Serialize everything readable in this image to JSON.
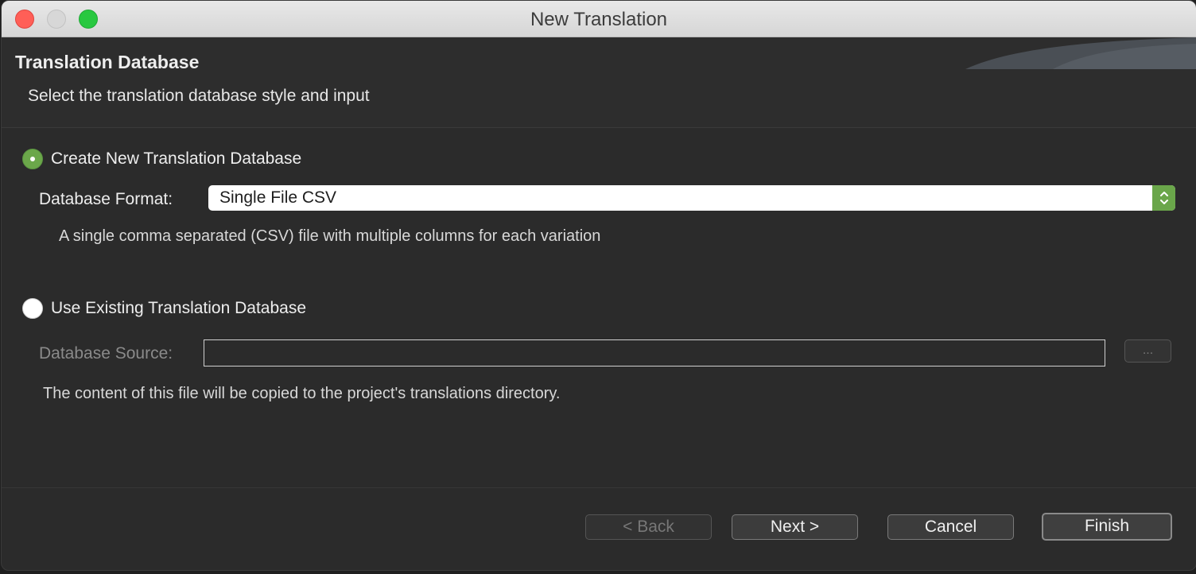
{
  "window": {
    "title": "New Translation"
  },
  "banner": {
    "title": "Translation Database",
    "subtitle": "Select the translation database style and input"
  },
  "create_new": {
    "label": "Create New Translation Database",
    "selected": true,
    "format_label": "Database Format:",
    "format_value": "Single File CSV",
    "format_description": "A single comma separated (CSV) file with multiple columns for each variation"
  },
  "use_existing": {
    "label": "Use Existing Translation Database",
    "selected": false,
    "source_label": "Database Source:",
    "source_value": "",
    "browse_label": "...",
    "note": "The content of this file will be copied to the project's translations directory."
  },
  "buttons": {
    "back": "< Back",
    "next": "Next >",
    "cancel": "Cancel",
    "finish": "Finish"
  },
  "colors": {
    "accent": "#6ba74a",
    "close": "#ff5f57",
    "zoom": "#28c840"
  }
}
